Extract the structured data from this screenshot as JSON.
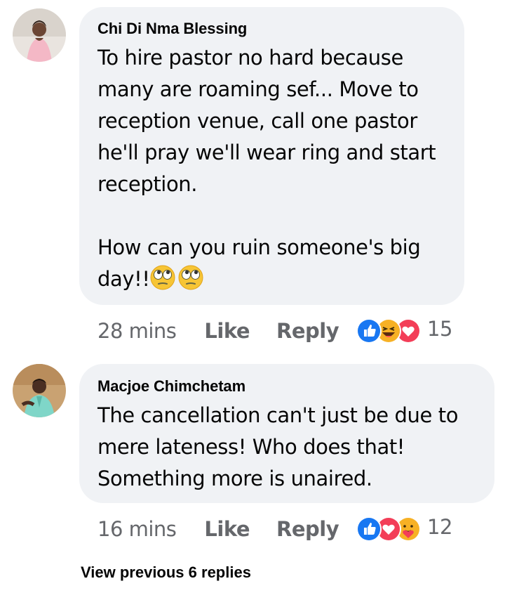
{
  "comments": [
    {
      "author": "Chi Di Nma Blessing",
      "avatar_icon": "profile-photo-woman-pink-dress",
      "text_main": "To hire pastor no hard because\nmany are roaming sef... Move to\nreception venue, call one pastor\nhe'll pray we'll wear ring and start\nreception.\n\nHow can you ruin someone's big\n",
      "text_tail": "day!!",
      "trailing_emojis": [
        "face-with-rolling-eyes-icon",
        "face-with-rolling-eyes-icon"
      ],
      "time": "28 mins",
      "like_label": "Like",
      "reply_label": "Reply",
      "reactions": [
        "like-icon",
        "haha-icon",
        "love-icon"
      ],
      "reaction_count": "15"
    },
    {
      "author": "Macjoe Chimchetam",
      "avatar_icon": "profile-photo-man-teal-outfit",
      "text_main": "The cancellation can't just be due to\nmere lateness! Who does that!\nSomething more is unaired.",
      "time": "16 mins",
      "like_label": "Like",
      "reply_label": "Reply",
      "reactions": [
        "like-icon",
        "love-icon",
        "care-icon"
      ],
      "reaction_count": "12"
    }
  ],
  "view_previous_label": "View previous 6 replies",
  "colors": {
    "bubble": "#f0f2f5",
    "text": "#050505",
    "meta": "#65676b",
    "like_blue": "#1877f2",
    "love_red": "#f33e58",
    "emoji_yellow": "#f7b125"
  }
}
